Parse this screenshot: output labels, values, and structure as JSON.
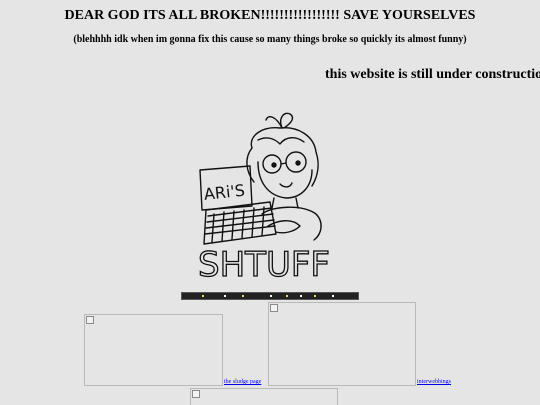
{
  "header": {
    "title": "DEAR GOD ITS ALL BROKEN!!!!!!!!!!!!!!!!! SAVE YOURSELVES",
    "subtitle": "(blehhhh idk when im gonna fix this cause so many things broke so quickly its almost funny)"
  },
  "notice": {
    "text": "this website is still under construction"
  },
  "logo": {
    "sign_text": "ARi'S",
    "word_text": "SHTUFF"
  },
  "links": {
    "sludge_page": "the sludge page",
    "interwebbings": "interwebbings"
  },
  "colors": {
    "background": "#e5e5e5",
    "link": "#0000ee"
  }
}
